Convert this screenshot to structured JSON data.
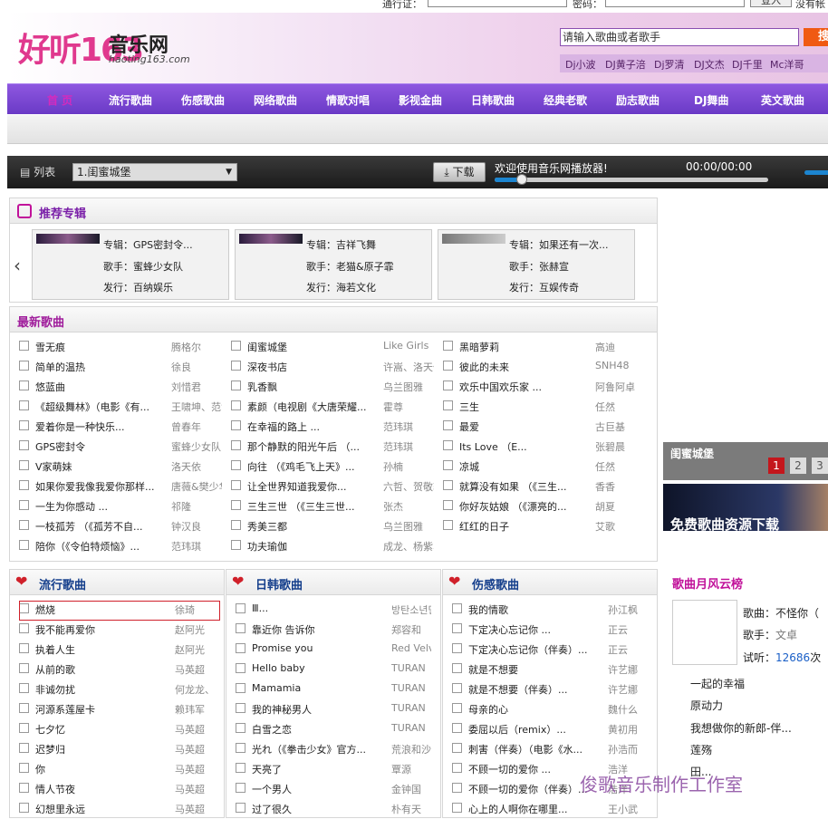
{
  "top": {
    "user_label": "通行证：",
    "pwd_label": "密码：",
    "login_btn": "登入",
    "note": "没有帐"
  },
  "logo": {
    "brand": "好听163",
    "cn": "音乐网",
    "url": "haoting163.com"
  },
  "search": {
    "placeholder": "请输入歌曲或者歌手",
    "button": "搜"
  },
  "dj_links": [
    "Dj小波",
    "DJ黄子涪",
    "Dj罗清",
    "DJ文杰",
    "DJ千里",
    "Mc洋哥"
  ],
  "nav": [
    "首 页",
    "流行歌曲",
    "伤感歌曲",
    "网络歌曲",
    "情歌对唱",
    "影视金曲",
    "日韩歌曲",
    "经典老歌",
    "励志歌曲",
    "DJ舞曲",
    "英文歌曲"
  ],
  "player": {
    "list_label": "列表",
    "current_track": "1.闺蜜城堡",
    "download": "下载",
    "welcome": "欢迎使用音乐网播放器!",
    "time": "00:00/00:00",
    "progress": 0.1
  },
  "recommend": {
    "title": "推荐专辑",
    "album_label": "专辑：",
    "singer_label": "歌手：",
    "publisher_label": "发行：",
    "cards": [
      {
        "album": "GPS密封令...",
        "singer": "蜜蜂少女队",
        "publisher": "百纳娱乐"
      },
      {
        "album": "吉祥飞舞",
        "singer": "老猫&原子霏",
        "publisher": "海若文化"
      },
      {
        "album": "如果还有一次...",
        "singer": "张赫宣",
        "publisher": "互娱传奇"
      }
    ]
  },
  "latest": {
    "title": "最新歌曲",
    "columns": [
      [
        {
          "t": "雪无痕",
          "a": "腾格尔"
        },
        {
          "t": "简单的温热",
          "a": "徐良"
        },
        {
          "t": "悠蓝曲",
          "a": "刘惜君"
        },
        {
          "t": "《超级舞林》（电影《有...",
          "a": "王啸坤、范世琪"
        },
        {
          "t": "爱着你是一种快乐...",
          "a": "曾春年"
        },
        {
          "t": "GPS密封令",
          "a": "蜜蜂少女队"
        },
        {
          "t": "V家萌妹",
          "a": "洛天依"
        },
        {
          "t": "如果你爱我像我爱你那样...",
          "a": "唐薇&樊少华"
        },
        {
          "t": "一生为你感动 ...",
          "a": "祁隆"
        },
        {
          "t": "一枝孤芳 （《孤芳不自...",
          "a": "钟汉良"
        },
        {
          "t": "陪你（《令伯特烦恼》...",
          "a": "范玮琪"
        }
      ],
      [
        {
          "t": "闺蜜城堡",
          "a": "Like Girls"
        },
        {
          "t": "深夜书店",
          "a": "许嵩、洛天依"
        },
        {
          "t": "乳香飘",
          "a": "乌兰图雅"
        },
        {
          "t": "素颜（电视剧《大唐荣耀...",
          "a": "霍尊"
        },
        {
          "t": "在幸福的路上 ...",
          "a": "范玮琪"
        },
        {
          "t": "那个静默的阳光午后 （...",
          "a": "范玮琪"
        },
        {
          "t": "向往 （《鸡毛飞上天》...",
          "a": "孙楠"
        },
        {
          "t": "让全世界知道我爱你...",
          "a": "六哲、贺敬轩"
        },
        {
          "t": "三生三世 （《三生三世...",
          "a": "张杰"
        },
        {
          "t": "秀美三都",
          "a": "乌兰图雅"
        },
        {
          "t": "功夫瑜伽",
          "a": "成龙、杨紫、张一山"
        }
      ],
      [
        {
          "t": "黑暗萝莉",
          "a": "高迪"
        },
        {
          "t": "彼此的未来",
          "a": "SNH48"
        },
        {
          "t": "欢乐中国欢乐家 ...",
          "a": "阿鲁阿卓"
        },
        {
          "t": "三生",
          "a": "任然"
        },
        {
          "t": "最爱",
          "a": "古巨基"
        },
        {
          "t": "Its Love （E...",
          "a": "张碧晨"
        },
        {
          "t": "凉城",
          "a": "任然"
        },
        {
          "t": "就算没有如果 （《三生...",
          "a": "香香"
        },
        {
          "t": "你好灰姑娘 （《漂亮的...",
          "a": "胡夏"
        },
        {
          "t": "红红的日子",
          "a": "艾歌"
        }
      ]
    ]
  },
  "pop": {
    "title": "流行歌曲",
    "songs": [
      {
        "t": "燃烧",
        "a": "徐琦"
      },
      {
        "t": "我不能再爱你",
        "a": "赵阿光"
      },
      {
        "t": "执着人生",
        "a": "赵阿光"
      },
      {
        "t": "从前的歌",
        "a": "马英超"
      },
      {
        "t": "非诚勿扰",
        "a": "何龙龙、杨艳萍"
      },
      {
        "t": "河源系莲屋卡",
        "a": "赖玮军"
      },
      {
        "t": "七夕忆",
        "a": "马英超"
      },
      {
        "t": "迟梦归",
        "a": "马英超"
      },
      {
        "t": "你",
        "a": "马英超"
      },
      {
        "t": "情人节夜",
        "a": "马英超"
      },
      {
        "t": "幻想里永远",
        "a": "马英超"
      }
    ]
  },
  "jk": {
    "title": "日韩歌曲",
    "songs": [
      {
        "t": "Ⅲ...",
        "a": "방탄소년단（防弹少年团）"
      },
      {
        "t": "靠近你 告诉你",
        "a": "郑容和"
      },
      {
        "t": "Promise you",
        "a": "Red Velvet"
      },
      {
        "t": "Hello baby",
        "a": "TURAN"
      },
      {
        "t": "Mamamia",
        "a": "TURAN"
      },
      {
        "t": "我的神秘男人",
        "a": "TURAN"
      },
      {
        "t": "白雪之恋",
        "a": "TURAN"
      },
      {
        "t": "光れ（《拳击少女》官方...",
        "a": "荒浪和沙"
      },
      {
        "t": "天亮了",
        "a": "覃源"
      },
      {
        "t": "一个男人",
        "a": "金钟国"
      },
      {
        "t": "过了很久",
        "a": "朴有天"
      }
    ]
  },
  "sad": {
    "title": "伤感歌曲",
    "songs": [
      {
        "t": "我的情歌",
        "a": "孙江枫"
      },
      {
        "t": "下定决心忘记你 ...",
        "a": "正云"
      },
      {
        "t": "下定决心忘记你（伴奏）...",
        "a": "正云"
      },
      {
        "t": "就是不想要",
        "a": "许艺娜"
      },
      {
        "t": "就是不想要（伴奏）...",
        "a": "许艺娜"
      },
      {
        "t": "母亲的心",
        "a": "魏什么"
      },
      {
        "t": "委屈以后（remix）...",
        "a": "黄初用"
      },
      {
        "t": "刺害（伴奏）（电影《水...",
        "a": "孙浩而"
      },
      {
        "t": "不顾一切的爱你 ...",
        "a": "浩洋"
      },
      {
        "t": "不顾一切的爱你（伴奏）...",
        "a": "浩洋"
      },
      {
        "t": "心上的人啊你在哪里...",
        "a": "王小武"
      }
    ]
  },
  "side": {
    "current": "闺蜜城堡",
    "pages": [
      "1",
      "2",
      "3"
    ],
    "banner": "免费歌曲资源下载"
  },
  "ranking": {
    "title": "歌曲月风云榜",
    "song_label": "歌曲：",
    "song": "不怪你（",
    "singer_label": "歌手：",
    "singer": "文卓",
    "listen_label": "试听：",
    "listens": "12686",
    "listen_unit": "次",
    "list": [
      "一起的幸福",
      "原动力",
      "我想做你的新郎-伴...",
      "莲殇",
      "田..."
    ]
  },
  "watermark": "俊歌音乐制作工作室",
  "colors": {
    "nav": "#7a45d3",
    "accent": "#c1129a",
    "search_btn": "#f05a12"
  }
}
